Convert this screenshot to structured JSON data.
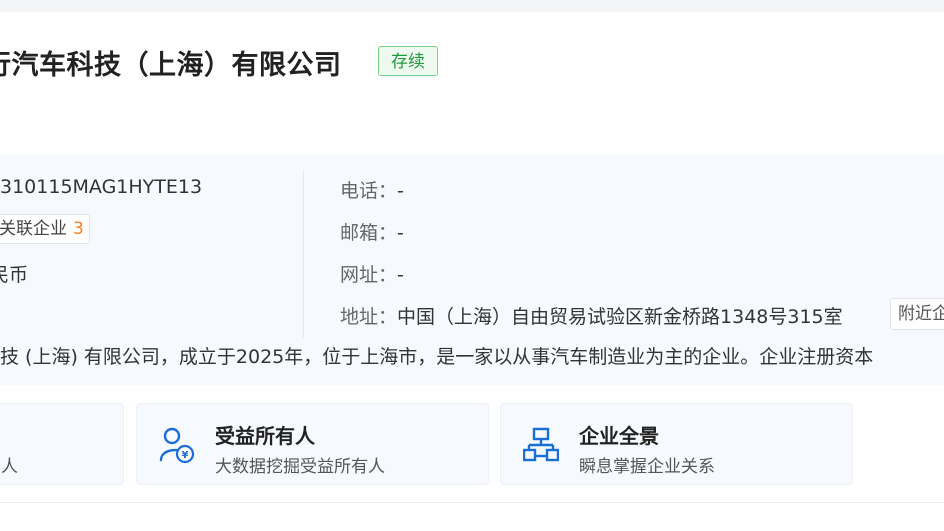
{
  "company": {
    "name": "行汽车科技（上海）有限公司",
    "status": "存续"
  },
  "info": {
    "credit_code": "310115MAG1HYTE13",
    "related_label": "关联企业",
    "related_count": "3",
    "currency": "民币",
    "phone_label": "电话：",
    "phone_value": "-",
    "email_label": "邮箱：",
    "email_value": "-",
    "website_label": "网址：",
    "website_value": "-",
    "address_label": "地址：",
    "address_value": "中国（上海）自由贸易试验区新金桥路1348号315室",
    "nearby_label": "附近企业"
  },
  "description": "技 (上海) 有限公司，成立于2025年，位于上海市，是一家以从事汽车制造业为主的企业。企业注册资本",
  "features": [
    {
      "title": "",
      "subtitle": "人",
      "icon": "user-icon"
    },
    {
      "title": "受益所有人",
      "subtitle": "大数据挖掘受益所有人",
      "icon": "beneficiary-icon"
    },
    {
      "title": "企业全景",
      "subtitle": "瞬息掌握企业关系",
      "icon": "org-chart-icon"
    }
  ],
  "colors": {
    "status_green": "#1f9b3b",
    "accent_blue": "#1a6ed8",
    "count_orange": "#ff7a1a"
  }
}
